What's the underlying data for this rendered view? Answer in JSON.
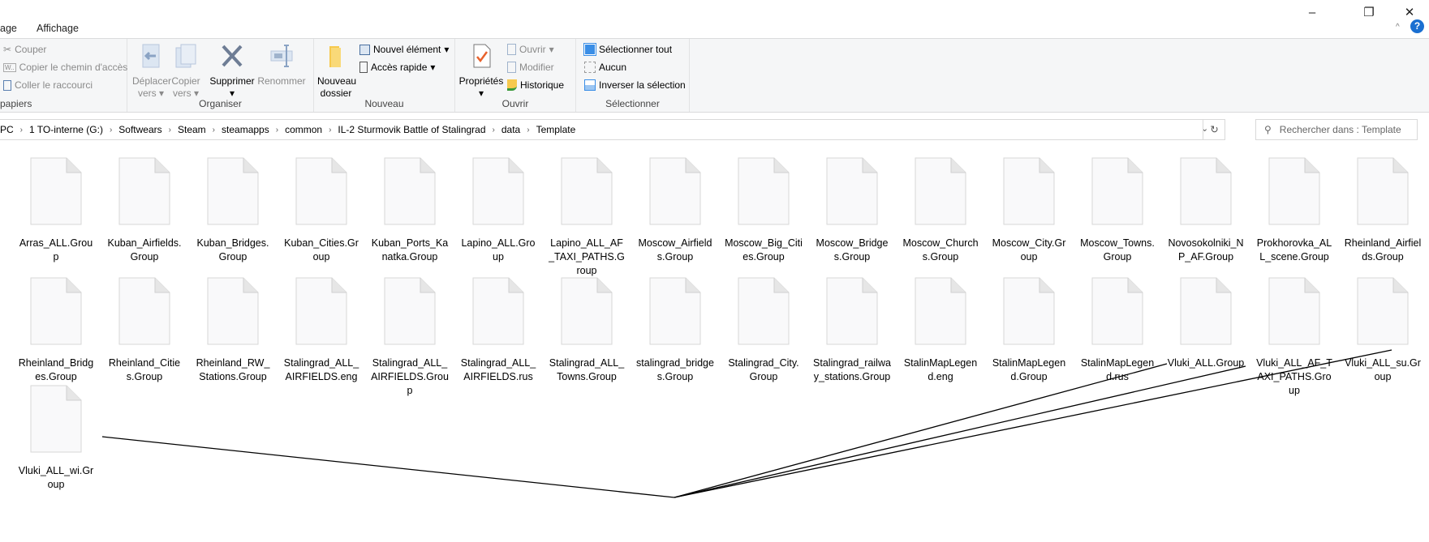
{
  "window": {
    "controls": {
      "minimize": "–",
      "maximize": "❐",
      "close": "✕"
    }
  },
  "tabs": [
    {
      "label": "age"
    },
    {
      "label": "Affichage"
    }
  ],
  "ribbon": {
    "clipboard": {
      "group_label": "papiers",
      "cut": "Couper",
      "copy_path": "Copier le chemin d'accès",
      "paste_shortcut": "Coller le raccourci"
    },
    "organise": {
      "group_label": "Organiser",
      "move_to": "Déplacer vers",
      "copy_to": "Copier vers",
      "delete": "Supprimer",
      "rename": "Renommer"
    },
    "new": {
      "group_label": "Nouveau",
      "new_folder": "Nouveau dossier",
      "new_item": "Nouvel élément",
      "quick_access": "Accès rapide"
    },
    "open": {
      "group_label": "Ouvrir",
      "properties": "Propriétés",
      "open": "Ouvrir",
      "edit": "Modifier",
      "history": "Historique"
    },
    "select": {
      "group_label": "Sélectionner",
      "select_all": "Sélectionner tout",
      "select_none": "Aucun",
      "invert": "Inverser la sélection"
    }
  },
  "address": {
    "breadcrumbs": [
      "PC",
      "1 TO-interne (G:)",
      "Softwears",
      "Steam",
      "steamapps",
      "common",
      "IL-2 Sturmovik Battle of Stalingrad",
      "data",
      "Template"
    ],
    "search_placeholder": "Rechercher dans : Template"
  },
  "files": [
    "Arras_ALL.Group",
    "Kuban_Airfields.Group",
    "Kuban_Bridges.Group",
    "Kuban_Cities.Group",
    "Kuban_Ports_Kanatka.Group",
    "Lapino_ALL.Group",
    "Lapino_ALL_AF_TAXI_PATHS.Group",
    "Moscow_Airfields.Group",
    "Moscow_Big_Cities.Group",
    "Moscow_Bridges.Group",
    "Moscow_Churchs.Group",
    "Moscow_City.Group",
    "Moscow_Towns.Group",
    "Novosokolniki_NP_AF.Group",
    "Prokhorovka_ALL_scene.Group",
    "Rheinland_Airfields.Group",
    "Rheinland_Bridges.Group",
    "Rheinland_Cities.Group",
    "Rheinland_RW_Stations.Group",
    "Stalingrad_ALL_AIRFIELDS.eng",
    "Stalingrad_ALL_AIRFIELDS.Group",
    "Stalingrad_ALL_AIRFIELDS.rus",
    "Stalingrad_ALL_Towns.Group",
    "stalingrad_bridges.Group",
    "Stalingrad_City.Group",
    "Stalingrad_railway_stations.Group",
    "StalinMapLegend.eng",
    "StalinMapLegend.Group",
    "StalinMapLegend.rus",
    "Vluki_ALL.Group",
    "Vluki_ALL_AF_TAXI_PATHS.Group",
    "Vluki_ALL_su.Group",
    "Vluki_ALL_wi.Group"
  ],
  "colors": {
    "ribbon_bg": "#f5f6f7",
    "help_blue": "#1a6fd1",
    "annotation_line": "#000000"
  }
}
